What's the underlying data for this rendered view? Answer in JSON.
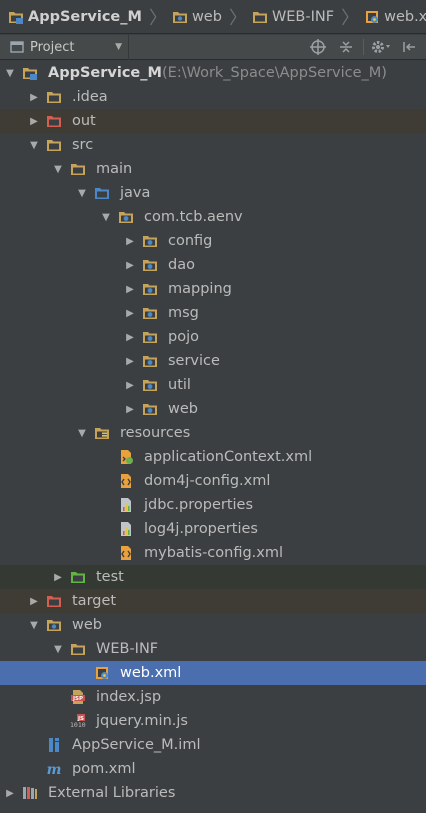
{
  "breadcrumb": [
    {
      "label": "AppService_M",
      "icon": "module-folder-icon"
    },
    {
      "label": "web",
      "icon": "web-folder-icon"
    },
    {
      "label": "WEB-INF",
      "icon": "folder-icon"
    },
    {
      "label": "web.xml",
      "icon": "web-xml-icon"
    }
  ],
  "toolbar": {
    "view_label": "Project"
  },
  "tree": [
    {
      "depth": 0,
      "arrow": "down",
      "icon": "module",
      "label": "AppService_M",
      "note": "(E:\\Work_Space\\AppService_M)",
      "bold": true
    },
    {
      "depth": 1,
      "arrow": "right",
      "icon": "folder",
      "label": ".idea"
    },
    {
      "depth": 1,
      "arrow": "right",
      "icon": "folder-excluded",
      "label": "out",
      "hl": "excluded"
    },
    {
      "depth": 1,
      "arrow": "down",
      "icon": "folder",
      "label": "src"
    },
    {
      "depth": 2,
      "arrow": "down",
      "icon": "folder",
      "label": "main"
    },
    {
      "depth": 3,
      "arrow": "down",
      "icon": "folder-source",
      "label": "java"
    },
    {
      "depth": 4,
      "arrow": "down",
      "icon": "package",
      "label": "com.tcb.aenv"
    },
    {
      "depth": 5,
      "arrow": "right",
      "icon": "package",
      "label": "config"
    },
    {
      "depth": 5,
      "arrow": "right",
      "icon": "package",
      "label": "dao"
    },
    {
      "depth": 5,
      "arrow": "right",
      "icon": "package",
      "label": "mapping"
    },
    {
      "depth": 5,
      "arrow": "right",
      "icon": "package",
      "label": "msg"
    },
    {
      "depth": 5,
      "arrow": "right",
      "icon": "package",
      "label": "pojo"
    },
    {
      "depth": 5,
      "arrow": "right",
      "icon": "package",
      "label": "service"
    },
    {
      "depth": 5,
      "arrow": "right",
      "icon": "package",
      "label": "util"
    },
    {
      "depth": 5,
      "arrow": "right",
      "icon": "package",
      "label": "web"
    },
    {
      "depth": 3,
      "arrow": "down",
      "icon": "folder-resources",
      "label": "resources"
    },
    {
      "depth": 4,
      "arrow": "none",
      "icon": "spring-xml",
      "label": "applicationContext.xml"
    },
    {
      "depth": 4,
      "arrow": "none",
      "icon": "xml",
      "label": "dom4j-config.xml"
    },
    {
      "depth": 4,
      "arrow": "none",
      "icon": "properties",
      "label": "jdbc.properties"
    },
    {
      "depth": 4,
      "arrow": "none",
      "icon": "properties",
      "label": "log4j.properties"
    },
    {
      "depth": 4,
      "arrow": "none",
      "icon": "xml",
      "label": "mybatis-config.xml"
    },
    {
      "depth": 2,
      "arrow": "right",
      "icon": "folder-test",
      "label": "test",
      "hl": "test"
    },
    {
      "depth": 1,
      "arrow": "right",
      "icon": "folder-excluded",
      "label": "target",
      "hl": "excluded"
    },
    {
      "depth": 1,
      "arrow": "down",
      "icon": "folder-web",
      "label": "web"
    },
    {
      "depth": 2,
      "arrow": "down",
      "icon": "folder",
      "label": "WEB-INF"
    },
    {
      "depth": 3,
      "arrow": "none",
      "icon": "web-xml",
      "label": "web.xml",
      "hl": "selected"
    },
    {
      "depth": 2,
      "arrow": "none",
      "icon": "jsp",
      "label": "index.jsp"
    },
    {
      "depth": 2,
      "arrow": "none",
      "icon": "js",
      "label": "jquery.min.js"
    },
    {
      "depth": 1,
      "arrow": "none",
      "icon": "iml",
      "label": "AppService_M.iml"
    },
    {
      "depth": 1,
      "arrow": "none",
      "icon": "maven",
      "label": "pom.xml"
    },
    {
      "depth": 0,
      "arrow": "right",
      "icon": "libraries",
      "label": "External Libraries"
    }
  ]
}
